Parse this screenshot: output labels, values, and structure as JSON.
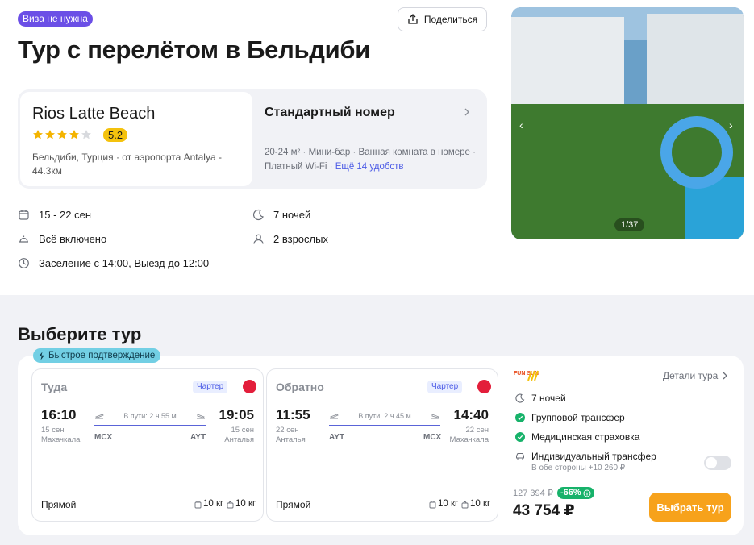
{
  "header": {
    "visa_badge": "Виза не нужна",
    "share_label": "Поделиться",
    "title": "Тур с перелётом в Бельдиби"
  },
  "hotel": {
    "name": "Rios Latte Beach",
    "stars": 4,
    "rating": "5.2",
    "location": "Бельдиби, Турция · от аэропорта Antalya - 44.3км",
    "room_title": "Стандартный номер",
    "room_features": "20-24 м² · Мини-бар · Ванная комната в номере · Платный Wi-Fi",
    "room_more": "Ещё 14 удобств"
  },
  "trip_info": {
    "dates": "15 - 22 сен",
    "nights": "7 ночей",
    "meals": "Всё включено",
    "guests": "2 взрослых",
    "checkin": "Заселение с 14:00, Выезд до 12:00"
  },
  "gallery": {
    "counter": "1/37",
    "prev": "‹",
    "next": "›"
  },
  "tour_section": {
    "title": "Выберите тур",
    "fast_badge": "Быстрое подтверждение",
    "outbound": {
      "title": "Туда",
      "charter": "Чартер",
      "dep_time": "16:10",
      "dep_date": "15 сен",
      "dep_city": "Махачкала",
      "dep_code": "MCX",
      "duration": "В пути: 2 ч 55 м",
      "arr_time": "19:05",
      "arr_date": "15 сен",
      "arr_city": "Анталья",
      "arr_code": "AYT",
      "direct": "Прямой",
      "bag1": "10 кг",
      "bag2": "10 кг"
    },
    "return": {
      "title": "Обратно",
      "charter": "Чартер",
      "dep_time": "11:55",
      "dep_date": "22 сен",
      "dep_city": "Анталья",
      "dep_code": "AYT",
      "duration": "В пути: 2 ч 45 м",
      "arr_time": "14:40",
      "arr_date": "22 сен",
      "arr_city": "Махачкала",
      "arr_code": "MCX",
      "direct": "Прямой",
      "bag1": "10 кг",
      "bag2": "10 кг"
    },
    "operator": "FUN SUN",
    "details": "Детали тура",
    "options": {
      "nights": "7 ночей",
      "transfer": "Групповой трансфер",
      "insurance": "Медицинская страховка",
      "individual": "Индивидуальный трансфер",
      "individual_sub": "В обе стороны +10 260 ₽"
    },
    "old_price": "127 394 ₽",
    "discount": "-66%",
    "price": "43 754 ₽",
    "choose": "Выбрать тур"
  },
  "colors": {
    "accent": "#6b4fe6",
    "primary_button": "#f7a21b",
    "discount": "#17b26a",
    "rating": "#f4c20d",
    "link": "#4c5be6"
  }
}
